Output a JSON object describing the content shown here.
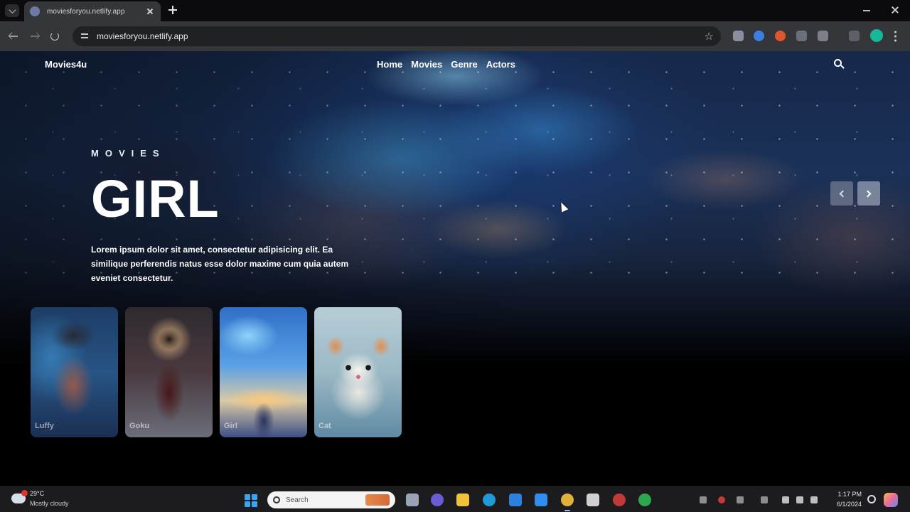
{
  "browser": {
    "tab_title": "moviesforyou.netlify.app",
    "url": "moviesforyou.netlify.app"
  },
  "site": {
    "brand": "Movies4u",
    "nav": [
      {
        "label": "Home"
      },
      {
        "label": "Movies"
      },
      {
        "label": "Genre"
      },
      {
        "label": "Actors"
      }
    ]
  },
  "hero": {
    "eyebrow": "MOVIES",
    "title": "GIRL",
    "description": "Lorem ipsum dolor sit amet, consectetur adipisicing elit. Ea similique perferendis natus esse dolor maxime cum quia autem eveniet consectetur."
  },
  "thumbnails": [
    {
      "label": "Luffy"
    },
    {
      "label": "Goku"
    },
    {
      "label": "Girl"
    },
    {
      "label": "Cat"
    }
  ],
  "taskbar": {
    "weather_temp": "29°C",
    "weather_condition": "Mostly cloudy",
    "search_placeholder": "Search",
    "time": "1:17 PM",
    "date": "6/1/2024"
  },
  "icons": {
    "search": "magnifier-icon",
    "prev": "chevron-left-icon",
    "next": "chevron-right-icon"
  },
  "colors": {
    "browser_chrome": "#35363a",
    "tab_strip": "#0b0b0d",
    "page_background": "#000000",
    "accent": "#3aa3f2"
  }
}
